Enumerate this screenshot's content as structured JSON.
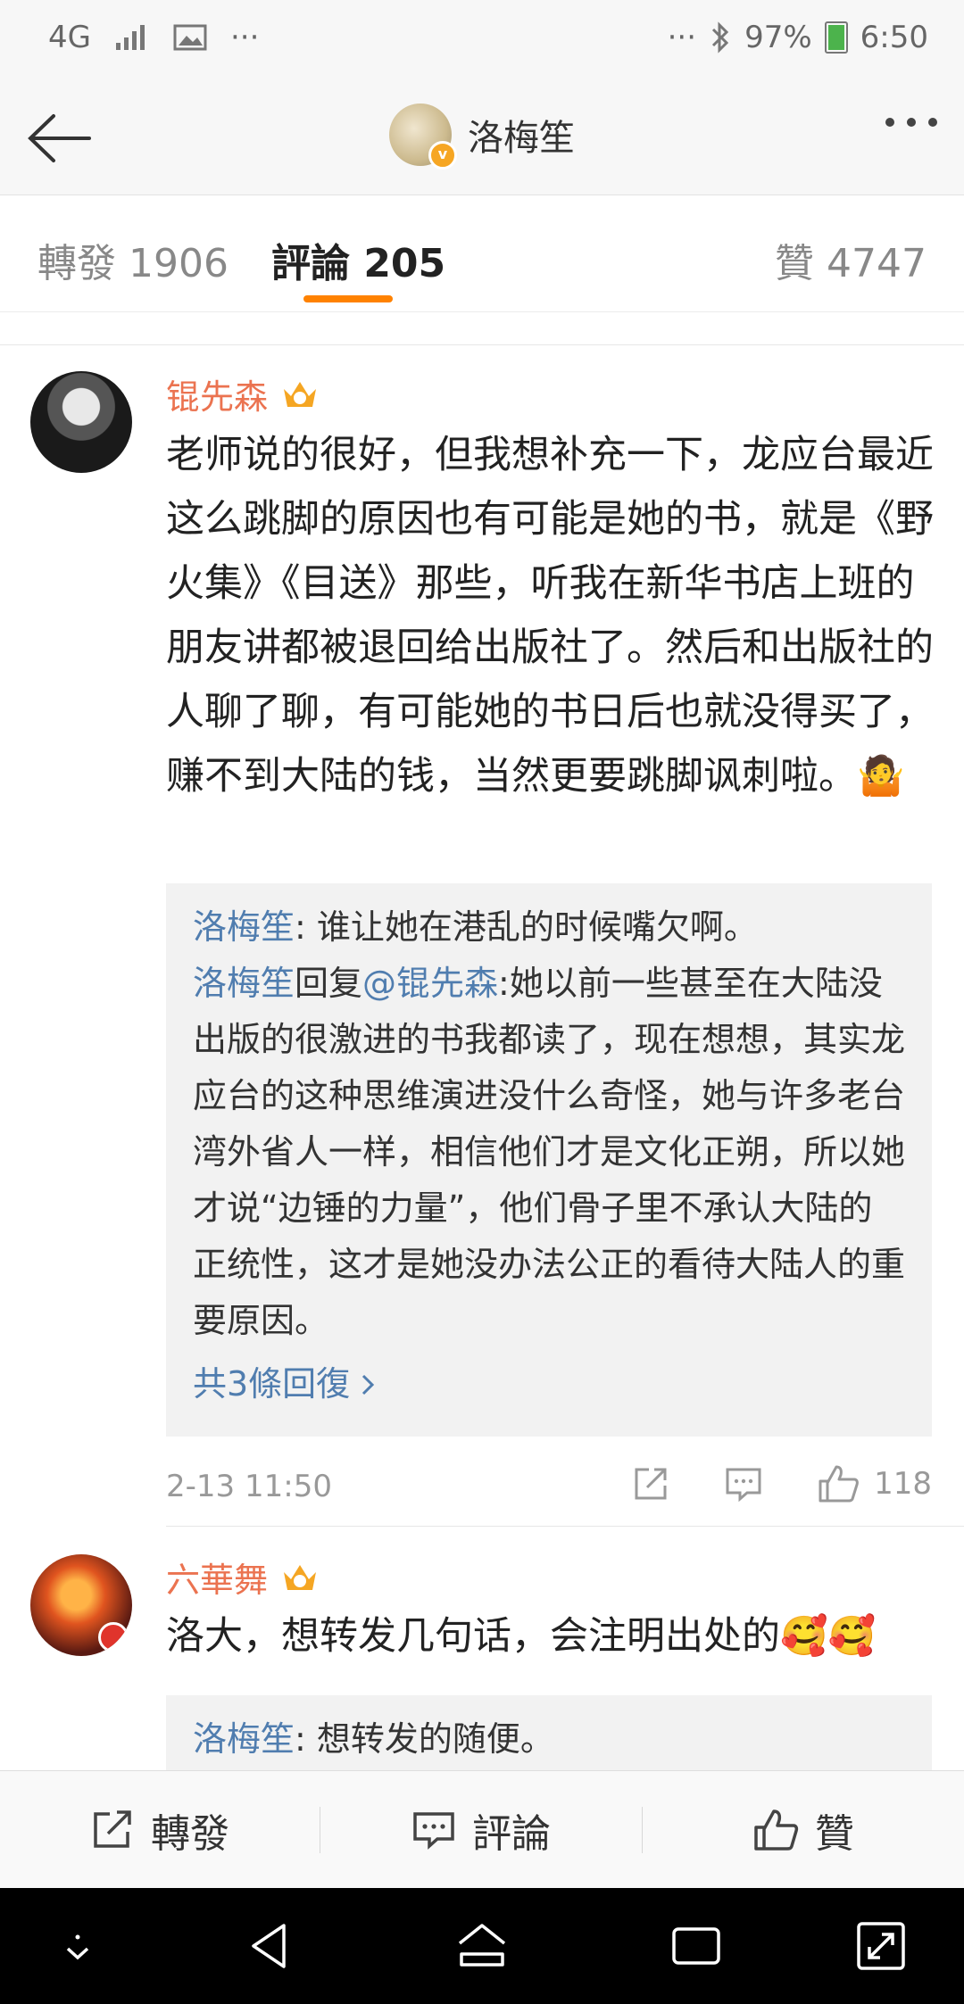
{
  "status_bar": {
    "network": "4G",
    "overflow": "···",
    "overflow_right": "···",
    "battery": "97%",
    "time": "6:50"
  },
  "header": {
    "title": "洛梅笙"
  },
  "tabs": [
    {
      "label": "轉發 1906"
    },
    {
      "label": "評論 205"
    },
    {
      "label": "贊 4747"
    }
  ],
  "comments": [
    {
      "author": "锟先森",
      "text": "老师说的很好，但我想补充一下，龙应台最近这么跳脚的原因也有可能是她的书，就是《野火集》《目送》那些，听我在新华书店上班的朋友讲都被退回给出版社了。然后和出版社的人聊了聊，有可能她的书日后也就没得买了，赚不到大陆的钱，当然更要跳脚讽刺啦。",
      "emoji": "🤷",
      "replies": [
        {
          "name": "洛梅笙",
          "text": ": 谁让她在港乱的时候嘴欠啊。"
        },
        {
          "name": "洛梅笙",
          "mid": "回复",
          "mention": "@锟先森",
          "text": ":她以前一些甚至在大陆没出版的很激进的书我都读了，现在想想，其实龙应台的这种思维演进没什么奇怪，她与许多老台湾外省人一样，相信他们才是文化正朔，所以她才说“边锤的力量”，他们骨子里不承认大陆的正统性，这才是她没办法公正的看待大陆人的重要原因。"
        }
      ],
      "more_replies": "共3條回復",
      "time": "2-13 11:50",
      "likes": "118"
    },
    {
      "author": "六華舞",
      "text": "洛大，想转发几句话，会注明出处的",
      "emoji": "🥰🥰",
      "replies": [
        {
          "name": "洛梅笙",
          "text": ": 想转发的随便。"
        }
      ]
    }
  ],
  "bottom_bar": {
    "repost": "轉發",
    "comment": "評論",
    "like": "贊"
  },
  "colors": {
    "accent": "#ff8200",
    "username": "#eb7350",
    "link": "#507daf"
  }
}
